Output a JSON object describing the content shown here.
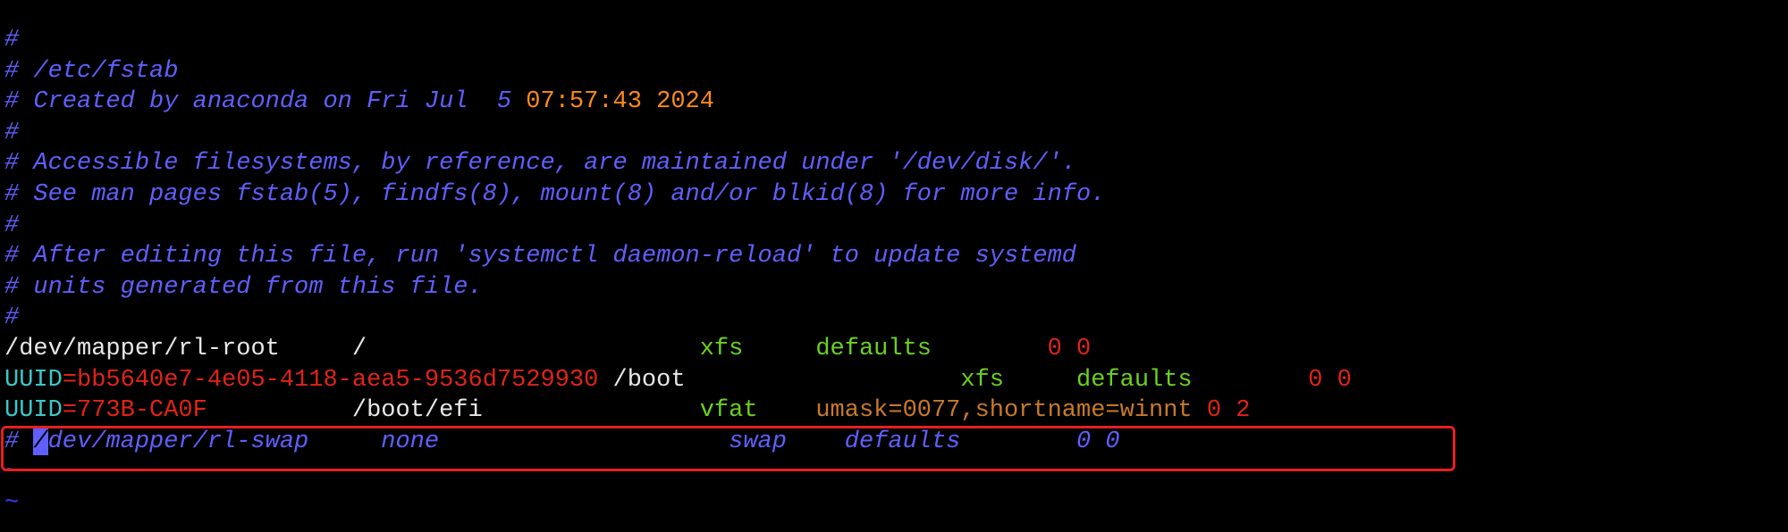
{
  "editor": {
    "lines": [
      {
        "segments": [
          {
            "text": "#",
            "cls": "comment"
          }
        ]
      },
      {
        "segments": [
          {
            "text": "# /etc/fstab",
            "cls": "comment"
          }
        ]
      },
      {
        "segments": [
          {
            "text": "# Created by anaconda on Fri Jul  5 ",
            "cls": "comment"
          },
          {
            "text": "07:57:43 2024",
            "cls": "orange"
          }
        ]
      },
      {
        "segments": [
          {
            "text": "#",
            "cls": "comment"
          }
        ]
      },
      {
        "segments": [
          {
            "text": "# Accessible filesystems, by reference, are maintained under '/dev/disk/'.",
            "cls": "comment"
          }
        ]
      },
      {
        "segments": [
          {
            "text": "# See man pages fstab(5), findfs(8), mount(8) and/or blkid(8) for more info.",
            "cls": "comment"
          }
        ]
      },
      {
        "segments": [
          {
            "text": "#",
            "cls": "comment"
          }
        ]
      },
      {
        "segments": [
          {
            "text": "# After editing this file, run 'systemctl daemon-reload' to update systemd",
            "cls": "comment"
          }
        ]
      },
      {
        "segments": [
          {
            "text": "# units generated from this file.",
            "cls": "comment"
          }
        ]
      },
      {
        "segments": [
          {
            "text": "#",
            "cls": "comment"
          }
        ]
      },
      {
        "segments": [
          {
            "text": "/dev/mapper/rl-root     /                       ",
            "cls": "white"
          },
          {
            "text": "xfs",
            "cls": "green"
          },
          {
            "text": "     ",
            "cls": "white"
          },
          {
            "text": "defaults",
            "cls": "green"
          },
          {
            "text": "        ",
            "cls": "white"
          },
          {
            "text": "0 0",
            "cls": "red"
          }
        ]
      },
      {
        "segments": [
          {
            "text": "UUID",
            "cls": "cyan"
          },
          {
            "text": "=bb5640e7-4e05-4118-aea5-9536d7529930",
            "cls": "red"
          },
          {
            "text": " /boot                   ",
            "cls": "white"
          },
          {
            "text": "xfs",
            "cls": "green"
          },
          {
            "text": "     ",
            "cls": "white"
          },
          {
            "text": "defaults",
            "cls": "green"
          },
          {
            "text": "        ",
            "cls": "white"
          },
          {
            "text": "0 0",
            "cls": "red"
          }
        ]
      },
      {
        "segments": [
          {
            "text": "UUID",
            "cls": "cyan"
          },
          {
            "text": "=773B-CA0F",
            "cls": "red"
          },
          {
            "text": "          /boot/efi               ",
            "cls": "white"
          },
          {
            "text": "vfat",
            "cls": "green"
          },
          {
            "text": "    ",
            "cls": "white"
          },
          {
            "text": "umask=0077,shortname=winnt",
            "cls": "brownish"
          },
          {
            "text": " ",
            "cls": "white"
          },
          {
            "text": "0 2",
            "cls": "red"
          }
        ]
      },
      {
        "segments": [
          {
            "text": "# ",
            "cls": "comment"
          },
          {
            "text": "/",
            "cls": "cursor-block"
          },
          {
            "text": "dev/mapper/rl-swap     none                    swap    defaults        0 0",
            "cls": "comment"
          }
        ]
      },
      {
        "segments": [
          {
            "text": "~",
            "cls": "tilde"
          }
        ]
      },
      {
        "segments": [
          {
            "text": "~",
            "cls": "tilde"
          }
        ]
      }
    ]
  }
}
